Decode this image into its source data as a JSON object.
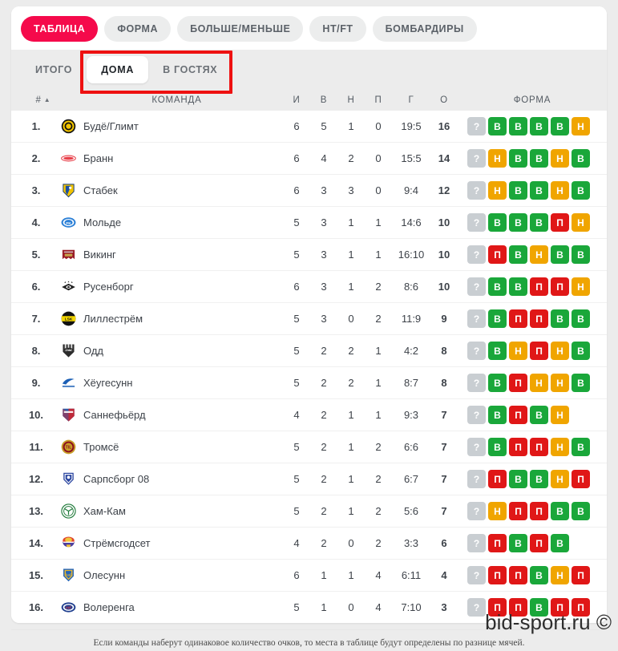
{
  "theme": {
    "accent": "#f50a4b",
    "win": "#1aa73a",
    "draw": "#f0a500",
    "loss": "#e01717",
    "unknown": "#c9ced2",
    "page_bg": "#ececec",
    "card_bg": "#ffffff",
    "annotation": "#ee1111"
  },
  "top_tabs": [
    {
      "label": "Таблица",
      "active": true
    },
    {
      "label": "Форма",
      "active": false
    },
    {
      "label": "Больше/Меньше",
      "active": false
    },
    {
      "label": "HT/FT",
      "active": false
    },
    {
      "label": "Бомбардиры",
      "active": false
    }
  ],
  "sub_tabs": [
    {
      "label": "Итого",
      "active": false
    },
    {
      "label": "Дома",
      "active": true
    },
    {
      "label": "В гостях",
      "active": false
    }
  ],
  "columns": {
    "rank": "#",
    "sort_caret": "▲",
    "team": "Команда",
    "played": "И",
    "won": "В",
    "drawn": "Н",
    "lost": "П",
    "goals": "Г",
    "points": "О",
    "form": "Форма"
  },
  "rows": [
    {
      "rank": "1.",
      "team": "Будё/Глимт",
      "logo": "bodo-glimt-logo",
      "played": "6",
      "won": "5",
      "drawn": "1",
      "lost": "0",
      "goals": "19:5",
      "points": "16",
      "form": [
        "?",
        "В",
        "В",
        "В",
        "В",
        "Н"
      ]
    },
    {
      "rank": "2.",
      "team": "Бранн",
      "logo": "brann-logo",
      "played": "6",
      "won": "4",
      "drawn": "2",
      "lost": "0",
      "goals": "15:5",
      "points": "14",
      "form": [
        "?",
        "Н",
        "В",
        "В",
        "Н",
        "В"
      ]
    },
    {
      "rank": "3.",
      "team": "Стабек",
      "logo": "stabaek-logo",
      "played": "6",
      "won": "3",
      "drawn": "3",
      "lost": "0",
      "goals": "9:4",
      "points": "12",
      "form": [
        "?",
        "Н",
        "В",
        "В",
        "Н",
        "В"
      ]
    },
    {
      "rank": "4.",
      "team": "Мольде",
      "logo": "molde-logo",
      "played": "5",
      "won": "3",
      "drawn": "1",
      "lost": "1",
      "goals": "14:6",
      "points": "10",
      "form": [
        "?",
        "В",
        "В",
        "В",
        "П",
        "Н"
      ]
    },
    {
      "rank": "5.",
      "team": "Викинг",
      "logo": "viking-logo",
      "played": "5",
      "won": "3",
      "drawn": "1",
      "lost": "1",
      "goals": "16:10",
      "points": "10",
      "form": [
        "?",
        "П",
        "В",
        "Н",
        "В",
        "В"
      ]
    },
    {
      "rank": "6.",
      "team": "Русенборг",
      "logo": "rosenborg-logo",
      "played": "6",
      "won": "3",
      "drawn": "1",
      "lost": "2",
      "goals": "8:6",
      "points": "10",
      "form": [
        "?",
        "В",
        "В",
        "П",
        "П",
        "Н"
      ]
    },
    {
      "rank": "7.",
      "team": "Лиллестрём",
      "logo": "lillestrom-logo",
      "played": "5",
      "won": "3",
      "drawn": "0",
      "lost": "2",
      "goals": "11:9",
      "points": "9",
      "form": [
        "?",
        "В",
        "П",
        "П",
        "В",
        "В"
      ]
    },
    {
      "rank": "8.",
      "team": "Одд",
      "logo": "odd-logo",
      "played": "5",
      "won": "2",
      "drawn": "2",
      "lost": "1",
      "goals": "4:2",
      "points": "8",
      "form": [
        "?",
        "В",
        "Н",
        "П",
        "Н",
        "В"
      ]
    },
    {
      "rank": "9.",
      "team": "Хёугесунн",
      "logo": "haugesund-logo",
      "played": "5",
      "won": "2",
      "drawn": "2",
      "lost": "1",
      "goals": "8:7",
      "points": "8",
      "form": [
        "?",
        "В",
        "П",
        "Н",
        "Н",
        "В"
      ]
    },
    {
      "rank": "10.",
      "team": "Саннефьёрд",
      "logo": "sandefjord-logo",
      "played": "4",
      "won": "2",
      "drawn": "1",
      "lost": "1",
      "goals": "9:3",
      "points": "7",
      "form": [
        "?",
        "В",
        "П",
        "В",
        "Н"
      ]
    },
    {
      "rank": "11.",
      "team": "Тромсё",
      "logo": "tromso-logo",
      "played": "5",
      "won": "2",
      "drawn": "1",
      "lost": "2",
      "goals": "6:6",
      "points": "7",
      "form": [
        "?",
        "В",
        "П",
        "П",
        "Н",
        "В"
      ]
    },
    {
      "rank": "12.",
      "team": "Сарпсборг 08",
      "logo": "sarpsborg-logo",
      "played": "5",
      "won": "2",
      "drawn": "1",
      "lost": "2",
      "goals": "6:7",
      "points": "7",
      "form": [
        "?",
        "П",
        "В",
        "В",
        "Н",
        "П"
      ]
    },
    {
      "rank": "13.",
      "team": "Хам-Кам",
      "logo": "ham-kam-logo",
      "played": "5",
      "won": "2",
      "drawn": "1",
      "lost": "2",
      "goals": "5:6",
      "points": "7",
      "form": [
        "?",
        "Н",
        "П",
        "П",
        "В",
        "В"
      ]
    },
    {
      "rank": "14.",
      "team": "Стрёмсгодсет",
      "logo": "stromsgodset-logo",
      "played": "4",
      "won": "2",
      "drawn": "0",
      "lost": "2",
      "goals": "3:3",
      "points": "6",
      "form": [
        "?",
        "П",
        "В",
        "П",
        "В"
      ]
    },
    {
      "rank": "15.",
      "team": "Олесунн",
      "logo": "aalesund-logo",
      "played": "6",
      "won": "1",
      "drawn": "1",
      "lost": "4",
      "goals": "6:11",
      "points": "4",
      "form": [
        "?",
        "П",
        "П",
        "В",
        "Н",
        "П"
      ]
    },
    {
      "rank": "16.",
      "team": "Волеренга",
      "logo": "valerenga-logo",
      "played": "5",
      "won": "1",
      "drawn": "0",
      "lost": "4",
      "goals": "7:10",
      "points": "3",
      "form": [
        "?",
        "П",
        "П",
        "В",
        "П",
        "П"
      ]
    }
  ],
  "footer": {
    "note": "Если команды наберут одинаковое количество очков, то места в таблице будут определены по разнице мячей."
  },
  "watermark": {
    "text": "bid-sport.ru ©"
  }
}
